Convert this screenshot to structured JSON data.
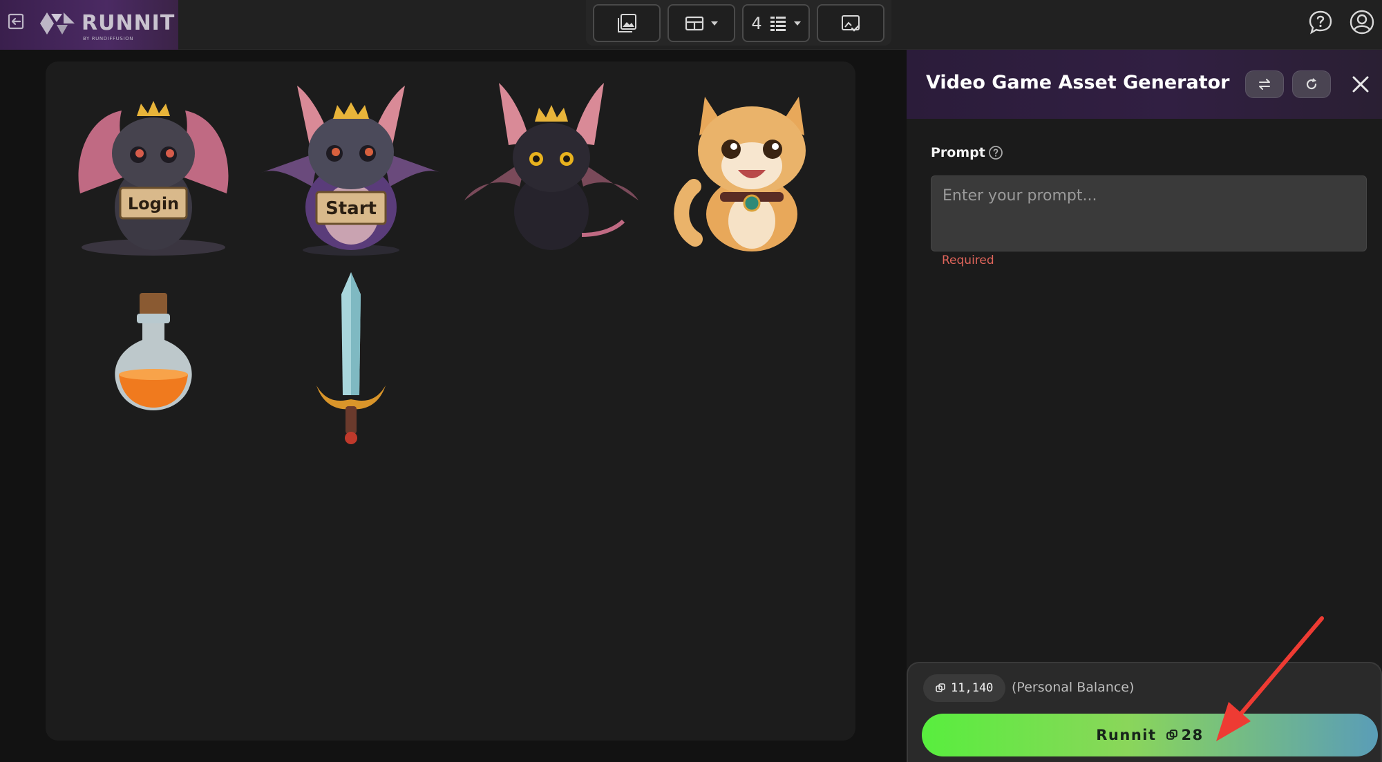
{
  "topbar": {
    "brand_name": "RUNNIT",
    "brand_sub": "BY RUNDIFFUSION",
    "columns_value": "4"
  },
  "panel": {
    "title": "Video Game Asset Generator",
    "prompt_label": "Prompt",
    "prompt_placeholder": "Enter your prompt...",
    "prompt_value": "",
    "required_text": "Required"
  },
  "gallery": {
    "items": [
      {
        "name": "bat-login",
        "sign": "Login"
      },
      {
        "name": "bat-start",
        "sign": "Start"
      },
      {
        "name": "bat-crown",
        "sign": ""
      },
      {
        "name": "cat",
        "sign": ""
      },
      {
        "name": "potion",
        "sign": ""
      },
      {
        "name": "sword",
        "sign": ""
      }
    ]
  },
  "footer": {
    "balance": "11,140",
    "balance_label": "(Personal Balance)",
    "runnit_label": "Runnit",
    "runnit_cost": "28"
  },
  "colors": {
    "accent_green": "#58ee3e",
    "accent_teal": "#5a9db7",
    "required_red": "#e0655b",
    "annotation_red": "#ee3b33"
  }
}
